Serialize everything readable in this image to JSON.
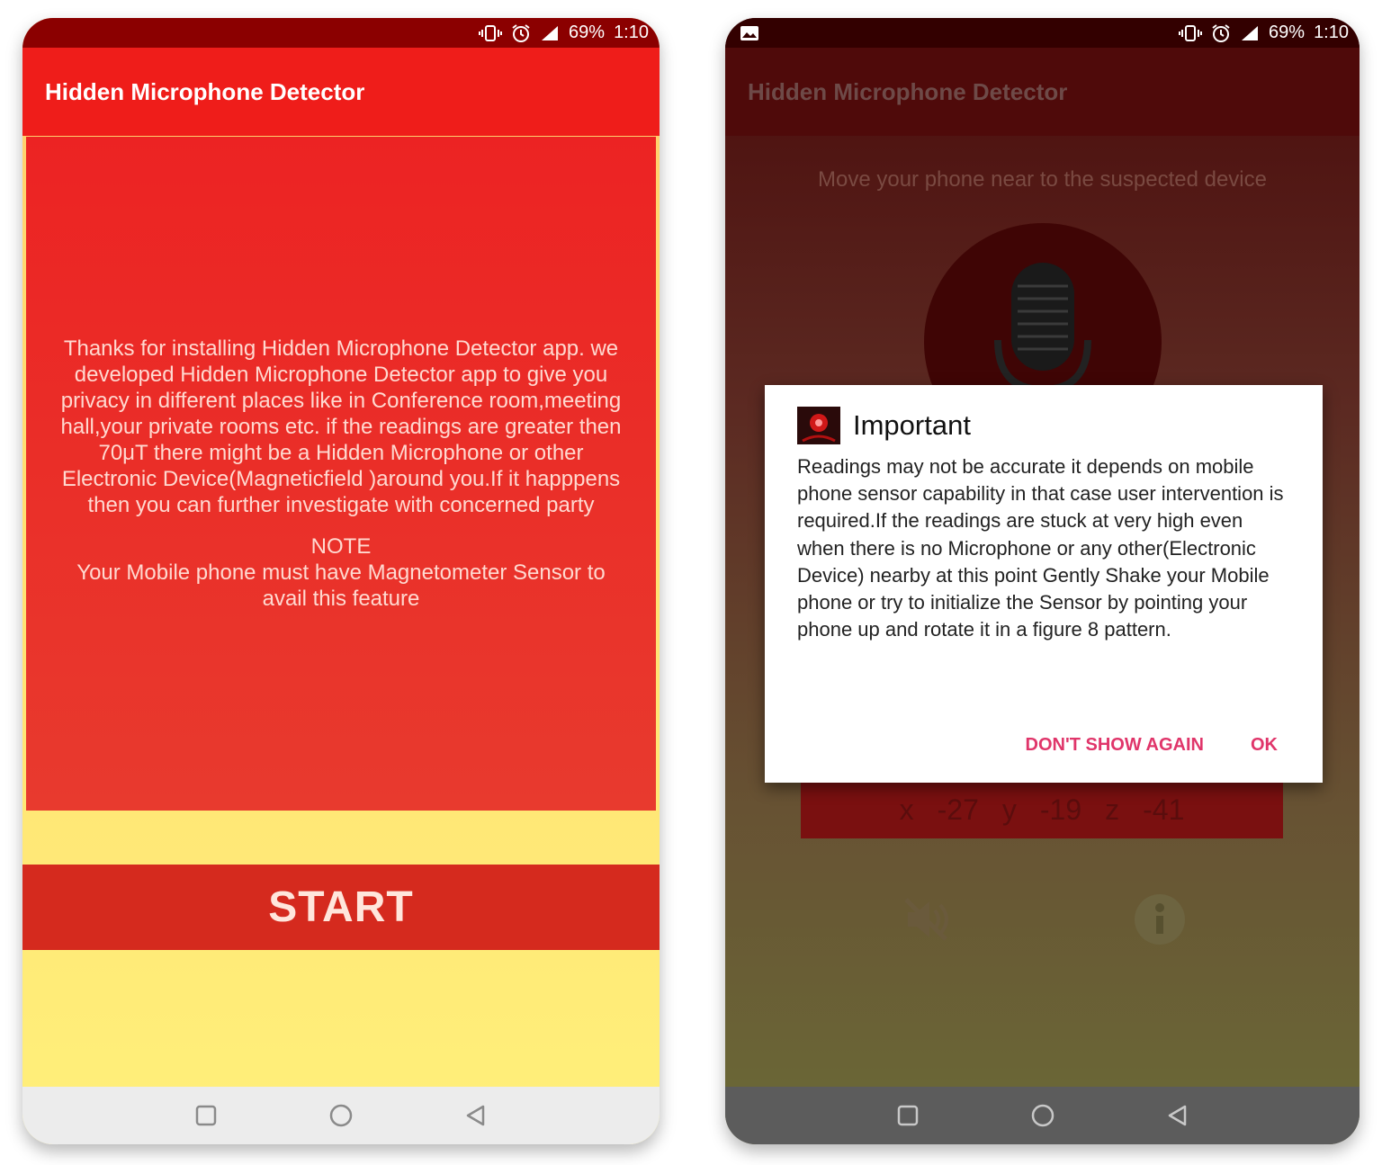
{
  "left_screen": {
    "status": {
      "battery": "69%",
      "time": "1:10"
    },
    "toolbar": {
      "title": "Hidden Microphone Detector"
    },
    "intro": {
      "text": "Thanks for installing Hidden Microphone Detector app. we developed Hidden Microphone Detector app to give you privacy in different places like in Conference room,meeting hall,your private rooms etc. if the readings are greater then 70μT there might be a Hidden Microphone or other Electronic Device(Magneticfield )around you.If it happpens then you can further investigate with concerned party",
      "note_title": "NOTE",
      "note_text": "Your Mobile phone must have Magnetometer Sensor to avail this feature"
    },
    "start_label": "START"
  },
  "right_screen": {
    "status": {
      "battery": "69%",
      "time": "1:10"
    },
    "toolbar": {
      "title": "Hidden Microphone Detector"
    },
    "hint": "Move your phone near to the suspected device",
    "readings": {
      "x_label": "x",
      "x": "-27",
      "y_label": "y",
      "y": "-19",
      "z_label": "z",
      "z": "-41"
    },
    "dialog": {
      "title": "Important",
      "message": "Readings may not be accurate it depends on mobile phone sensor capability in that case user intervention is required.If the readings are stuck at very high even when there is no Microphone or any other(Electronic Device) nearby at this point Gently Shake your Mobile phone or try to initialize the Sensor by pointing your phone up and rotate it in a figure 8 pattern.",
      "secondary_action": "DON'T SHOW AGAIN",
      "primary_action": "OK"
    }
  },
  "colors": {
    "toolbar_red": "#ef1d1a",
    "status_dark_red": "#8b0000",
    "start_button": "#d52a1e",
    "dialog_accent": "#e0356a"
  },
  "icons": [
    "vibrate-icon",
    "alarm-icon",
    "signal-icon",
    "image-notification-icon",
    "microphone-icon",
    "mute-icon",
    "info-icon",
    "recents-icon",
    "home-icon",
    "back-icon",
    "app-icon"
  ]
}
